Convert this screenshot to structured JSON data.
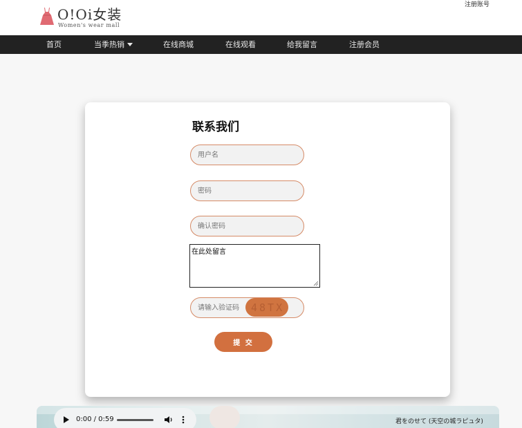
{
  "header": {
    "logo_title": "O!Oi女装",
    "logo_subtitle": "Women's wear mall",
    "register_link": "注册账号"
  },
  "nav": {
    "items": [
      {
        "label": "首页"
      },
      {
        "label": "当季热销",
        "has_dropdown": true
      },
      {
        "label": "在线商城"
      },
      {
        "label": "在线观看"
      },
      {
        "label": "给我留言"
      },
      {
        "label": "注册会员"
      }
    ]
  },
  "form": {
    "title": "联系我们",
    "username_placeholder": "用户名",
    "password_placeholder": "密码",
    "confirm_placeholder": "确认密码",
    "message_value": "在此处留言",
    "captcha_placeholder": "请输入验证码",
    "captcha_code": "48TX",
    "submit_label": "提 交"
  },
  "player": {
    "time": "0:00 / 0:59",
    "song_title": "君をのせて (天空の城ラピュタ)"
  },
  "colors": {
    "accent": "#d2703f",
    "nav_bg": "#222222",
    "page_bg": "#f7f7f7"
  }
}
